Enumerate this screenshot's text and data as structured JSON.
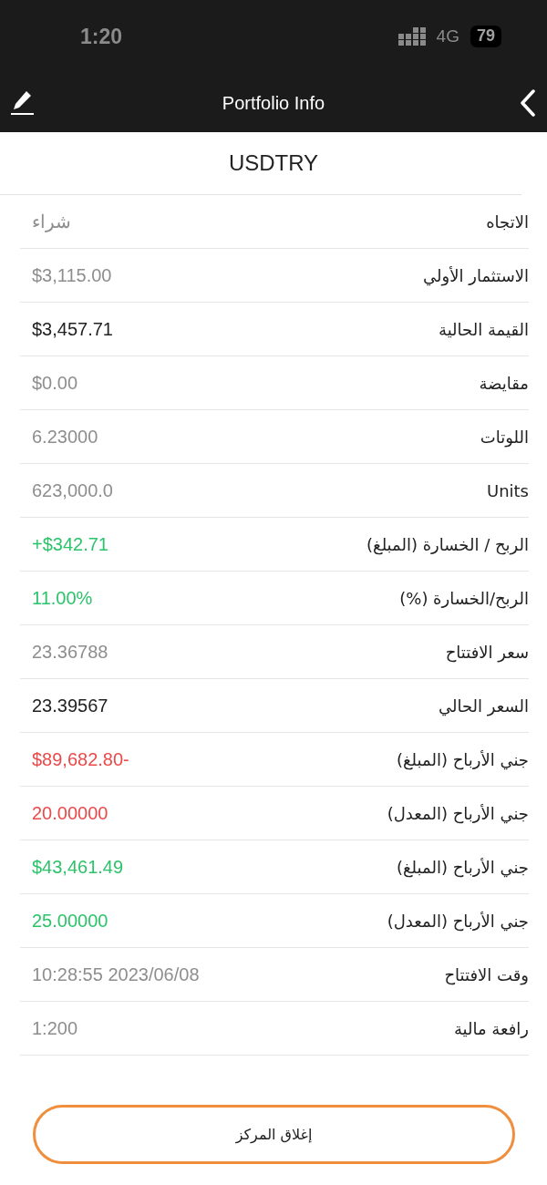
{
  "status_bar": {
    "time": "1:20",
    "network": "4G",
    "battery": "79"
  },
  "nav_bar": {
    "title": "Portfolio Info"
  },
  "symbol": "USDTRY",
  "rows": [
    {
      "label": "الاتجاه",
      "value": "شراء",
      "color": "#8e8e8e"
    },
    {
      "label": "الاستثمار الأولي",
      "value": "$3,115.00",
      "color": "#8e8e8e"
    },
    {
      "label": "القيمة الحالية",
      "value": "$3,457.71",
      "color": "#222222"
    },
    {
      "label": "مقايضة",
      "value": "$0.00",
      "color": "#8e8e8e"
    },
    {
      "label": "اللوتات",
      "value": "6.23000",
      "color": "#8e8e8e"
    },
    {
      "label": "Units",
      "value": "623,000.0",
      "color": "#8e8e8e"
    },
    {
      "label": "الربح / الخسارة (المبلغ)",
      "value": "+$342.71",
      "color": "#2cc36b"
    },
    {
      "label": "الربح/الخسارة (%)",
      "value": "11.00%",
      "color": "#2cc36b"
    },
    {
      "label": "سعر الافتتاح",
      "value": "23.36788",
      "color": "#8e8e8e"
    },
    {
      "label": "السعر الحالي",
      "value": "23.39567",
      "color": "#222222"
    },
    {
      "label": "جني الأرباح (المبلغ)",
      "value": "$89,682.80-",
      "color": "#ea4a4a"
    },
    {
      "label": "جني الأرباح (المعدل)",
      "value": "20.00000",
      "color": "#ea4a4a"
    },
    {
      "label": "جني الأرباح (المبلغ)",
      "value": "$43,461.49",
      "color": "#2cc36b"
    },
    {
      "label": "جني الأرباح (المعدل)",
      "value": "25.00000",
      "color": "#2cc36b"
    },
    {
      "label": "وقت الافتتاح",
      "value": "10:28:55 2023/06/08",
      "color": "#8e8e8e"
    },
    {
      "label": "رافعة مالية",
      "value": "1:200",
      "color": "#8e8e8e"
    }
  ],
  "close_button": {
    "label": "إغلاق المركز"
  }
}
